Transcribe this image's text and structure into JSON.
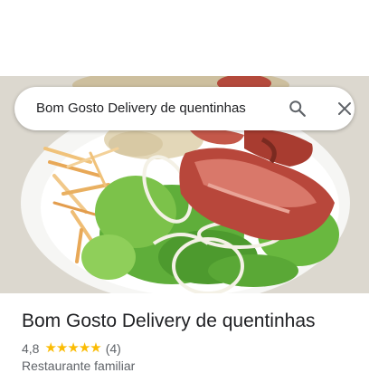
{
  "search": {
    "query": "Bom Gosto Delivery de quentinhas"
  },
  "icons": {
    "search": "search-icon",
    "close": "close-icon",
    "star": "star-icon"
  },
  "place": {
    "name": "Bom Gosto Delivery de quentinhas",
    "rating": "4,8",
    "rating_value": 4.8,
    "stars_filled": 5,
    "review_count": "(4)",
    "category": "Restaurante familiar"
  },
  "colors": {
    "star": "#fbbc04",
    "title_text": "#202124",
    "secondary_text": "#5f6368",
    "icon": "#5f6368"
  }
}
